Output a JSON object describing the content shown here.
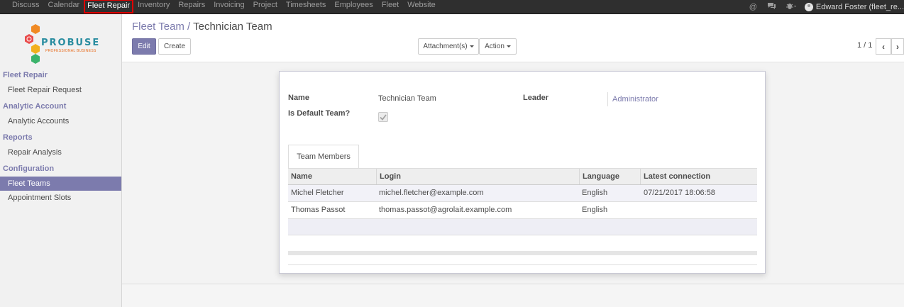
{
  "topbar": {
    "menu": [
      "Discuss",
      "Calendar",
      "Fleet Repair",
      "Inventory",
      "Repairs",
      "Invoicing",
      "Project",
      "Timesheets",
      "Employees",
      "Fleet",
      "Website"
    ],
    "active_menu": "Fleet Repair",
    "user_name": "Edward Foster (fleet_re..."
  },
  "logo": {
    "text": "PROBUSE",
    "subtext": "PROFESSIONAL BUSINESS"
  },
  "sidebar": {
    "sections": [
      {
        "title": "Fleet Repair",
        "items": [
          "Fleet Repair Request"
        ]
      },
      {
        "title": "Analytic Account",
        "items": [
          "Analytic Accounts"
        ]
      },
      {
        "title": "Reports",
        "items": [
          "Repair Analysis"
        ]
      },
      {
        "title": "Configuration",
        "items": [
          "Fleet Teams",
          "Appointment Slots"
        ]
      }
    ],
    "active_item": "Fleet Teams"
  },
  "breadcrumb": {
    "parent": "Fleet Team",
    "separator": "/",
    "current": "Technician Team"
  },
  "buttons": {
    "edit": "Edit",
    "create": "Create",
    "attachments": "Attachment(s)",
    "action": "Action"
  },
  "pager": {
    "value": "1 / 1"
  },
  "form": {
    "name_label": "Name",
    "name_value": "Technician Team",
    "leader_label": "Leader",
    "leader_value": "Administrator",
    "default_label": "Is Default Team?",
    "default_checked": true
  },
  "tab": {
    "label": "Team Members"
  },
  "members_table": {
    "columns": [
      "Name",
      "Login",
      "Language",
      "Latest connection"
    ],
    "rows": [
      [
        "Michel Fletcher",
        "michel.fletcher@example.com",
        "English",
        "07/21/2017 18:06:58"
      ],
      [
        "Thomas Passot",
        "thomas.passot@agrolait.example.com",
        "English",
        ""
      ]
    ]
  },
  "colors": {
    "accent": "#7c7bad",
    "topbar": "#2f2f2f",
    "highlight_box": "#e00000"
  }
}
